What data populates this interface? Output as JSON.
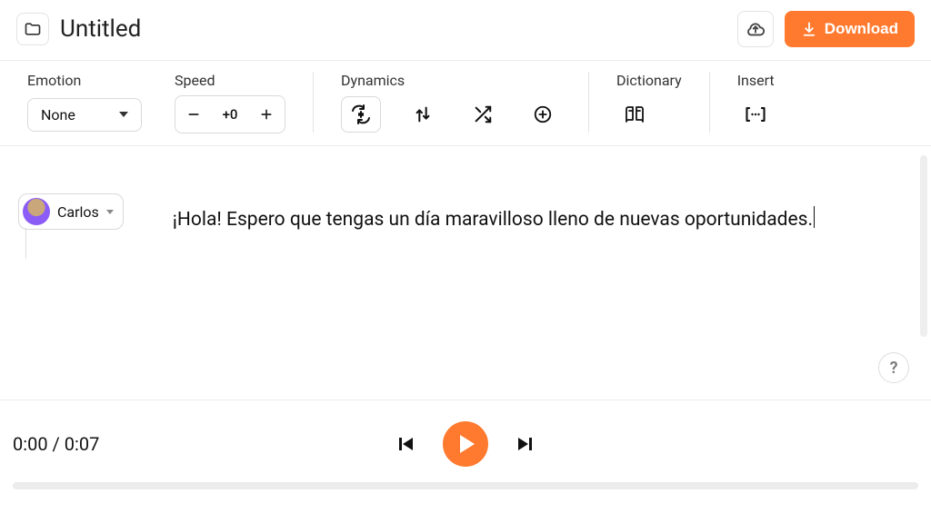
{
  "header": {
    "title": "Untitled",
    "download_label": "Download"
  },
  "toolbar": {
    "emotion": {
      "label": "Emotion",
      "value": "None"
    },
    "speed": {
      "label": "Speed",
      "value": "+0"
    },
    "dynamics": {
      "label": "Dynamics"
    },
    "dictionary": {
      "label": "Dictionary"
    },
    "insert": {
      "label": "Insert"
    }
  },
  "editor": {
    "speaker_name": "Carlos",
    "script_text": "¡Hola! Espero que tengas un día maravilloso lleno de nuevas oportunidades."
  },
  "player": {
    "time_current": "0:00",
    "time_sep": " / ",
    "time_total": "0:07"
  },
  "help": {
    "label": "?"
  },
  "colors": {
    "accent": "#ff7a2f"
  }
}
